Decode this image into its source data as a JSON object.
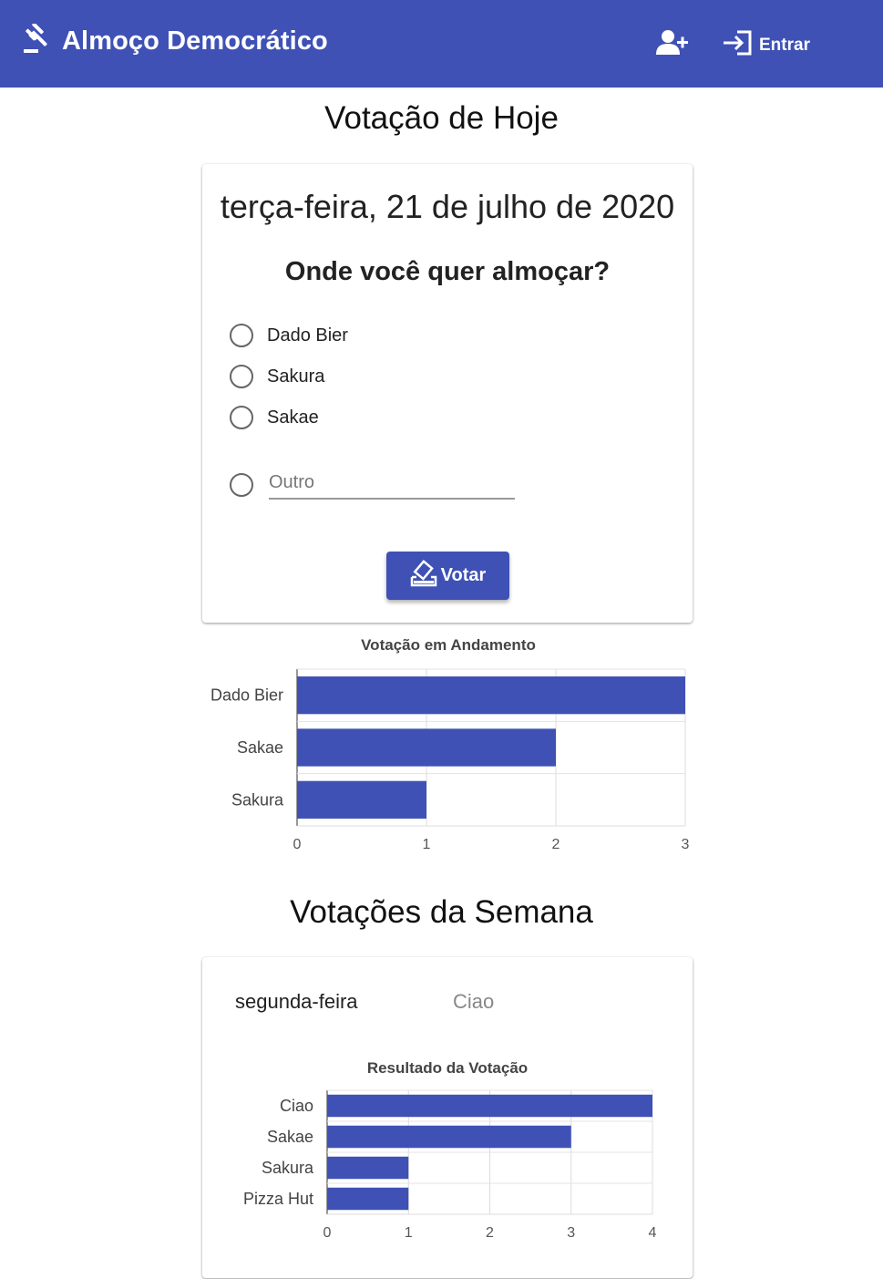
{
  "appbar": {
    "title": "Almoço Democrático",
    "login_label": "Entrar",
    "color": "#3f51b5"
  },
  "today": {
    "section_title": "Votação de Hoje",
    "date": "terça-feira, 21 de julho de 2020",
    "question": "Onde você quer almoçar?",
    "options": [
      "Dado Bier",
      "Sakura",
      "Sakae"
    ],
    "other_placeholder": "Outro",
    "vote_label": "Votar"
  },
  "week": {
    "section_title": "Votações da Semana",
    "days": [
      {
        "day": "segunda-feira",
        "winner": "Ciao"
      }
    ]
  },
  "chart_data": [
    {
      "type": "bar",
      "orientation": "horizontal",
      "title": "Votação em Andamento",
      "categories": [
        "Dado Bier",
        "Sakae",
        "Sakura"
      ],
      "values": [
        3,
        2,
        1
      ],
      "xlim": [
        0,
        3
      ],
      "ticks": [
        0,
        1,
        2,
        3
      ],
      "color": "#3f51b5",
      "grid": true
    },
    {
      "type": "bar",
      "orientation": "horizontal",
      "title": "Resultado da Votação",
      "categories": [
        "Ciao",
        "Sakae",
        "Sakura",
        "Pizza Hut"
      ],
      "values": [
        4,
        3,
        1,
        1
      ],
      "xlim": [
        0,
        4
      ],
      "ticks": [
        0,
        1,
        2,
        3,
        4
      ],
      "color": "#3f51b5",
      "grid": true
    }
  ]
}
